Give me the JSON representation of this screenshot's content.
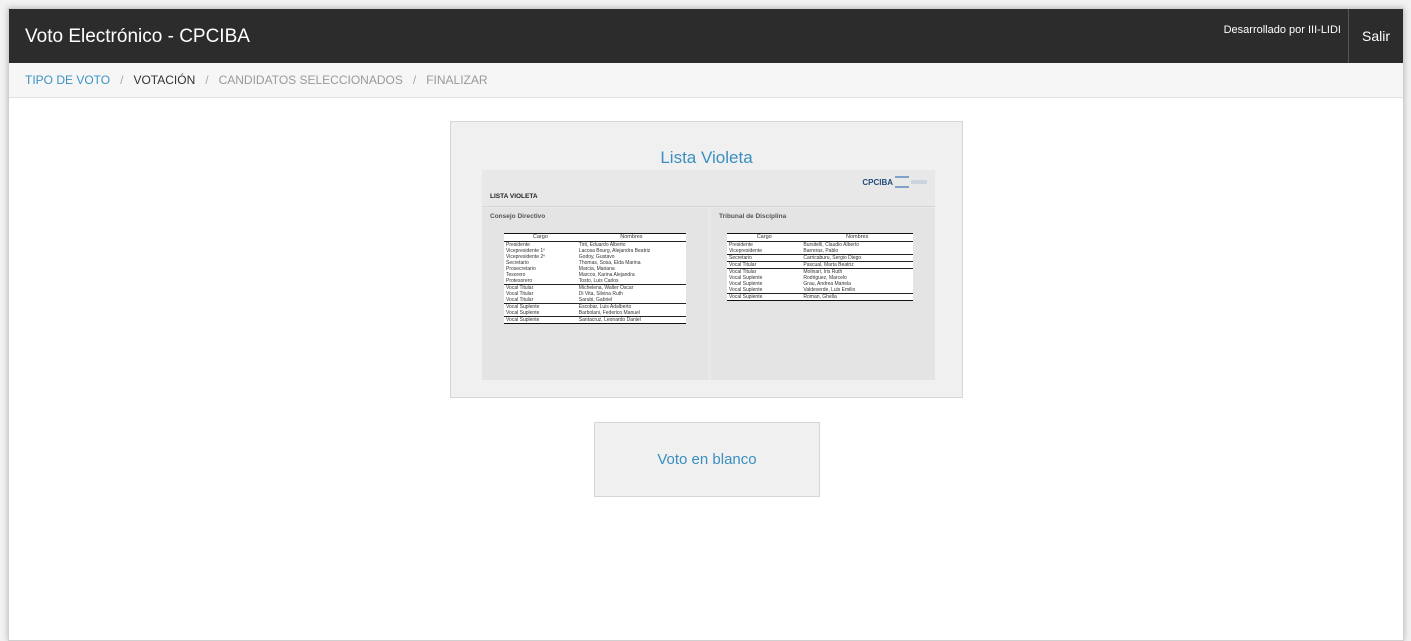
{
  "header": {
    "title": "Voto Electrónico - CPCIBA",
    "developed_by": "Desarrollado por III-LIDI",
    "logout_label": "Salir"
  },
  "breadcrumb": {
    "items": [
      {
        "label": "TIPO DE VOTO",
        "state": "active"
      },
      {
        "label": "VOTACIÓN",
        "state": "current"
      },
      {
        "label": "CANDIDATOS SELECCIONADOS",
        "state": "pending"
      },
      {
        "label": "FINALIZAR",
        "state": "pending"
      }
    ],
    "separator": "/"
  },
  "option_list": {
    "title": "Lista Violeta",
    "ballot": {
      "logo_text": "CPCIBA",
      "list_name": "LISTA VIOLETA",
      "left": {
        "title": "Consejo Directivo",
        "headers": [
          "Cargo",
          "Nombres"
        ],
        "rows": [
          [
            "Presidente",
            "Tirit, Eduardo Alberto"
          ],
          [
            "Vicepresidente 1º",
            "Lacosa Bourg, Alejandra Beatriz"
          ],
          [
            "Vicepresidente 2º",
            "Godoy, Gustavo"
          ],
          [
            "Secretario",
            "Thomas, Sosa, Elda Marina"
          ],
          [
            "Prosecretario",
            "Marcia, Mariana"
          ],
          [
            "Tesorero",
            "Marcos, Karina Alejandra"
          ],
          [
            "Protesorero",
            "Tosto, Luis Carlos"
          ],
          [
            "Vocal Titular",
            "Michelena, Walter Oscar"
          ],
          [
            "Vocal Titular",
            "Di Vita, Silvina Ruth"
          ],
          [
            "Vocal Titular",
            "Sarubi, Gabriel"
          ],
          [
            "Vocal Suplente",
            "Escobar, Luis Adalberto"
          ],
          [
            "Vocal Suplente",
            "Barbolani, Federico Manuel"
          ],
          [
            "Vocal Suplente",
            "Santacruz, Leonardo Daniel"
          ]
        ]
      },
      "right": {
        "title": "Tribunal de Disciplina",
        "headers": [
          "Cargo",
          "Nombres"
        ],
        "rows": [
          [
            "Presidente",
            "Bursitelli, Claudio Alberto"
          ],
          [
            "Vicepresidente",
            "Barreras, Pablo"
          ],
          [
            "Secretario",
            "Carricaburu, Sergio Diego"
          ],
          [
            "Vocal Titular",
            "Pascual, Marta Beatriz"
          ],
          [
            "Vocal Titular",
            "Molinari, Iris Ruth"
          ],
          [
            "Vocal Suplente",
            "Rodriguez, Marcelo"
          ],
          [
            "Vocal Suplente",
            "Grau, Andrea Mariela"
          ],
          [
            "Vocal Suplente",
            "Valdeverde, Luis Emilio"
          ],
          [
            "Vocal Suplente",
            "Roman, Ghella"
          ]
        ]
      }
    }
  },
  "option_blank": {
    "label": "Voto en blanco"
  },
  "colors": {
    "topbar": "#2c2c2c",
    "accent": "#3a93c4",
    "card_bg": "#f0f0f0"
  }
}
